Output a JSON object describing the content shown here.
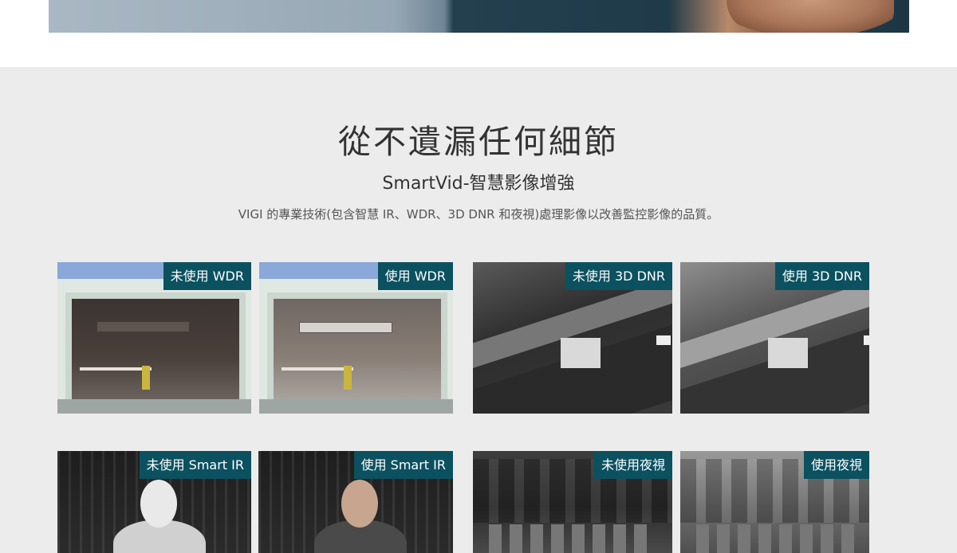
{
  "section": {
    "title": "從不遺漏任何細節",
    "subtitle": "SmartVid-智慧影像增強",
    "description": "VIGI 的專業技術(包含智慧 IR、WDR、3D DNR 和夜視)處理影像以改善監控影像的品質。"
  },
  "comparisons": [
    {
      "label": "未使用 WDR"
    },
    {
      "label": "使用 WDR"
    },
    {
      "label": "未使用 3D DNR"
    },
    {
      "label": "使用 3D DNR"
    },
    {
      "label": "未使用 Smart IR"
    },
    {
      "label": "使用 Smart IR"
    },
    {
      "label": "未使用夜視"
    },
    {
      "label": "使用夜視"
    }
  ],
  "colors": {
    "label_background": "#0b5160",
    "section_background": "#ececec"
  }
}
